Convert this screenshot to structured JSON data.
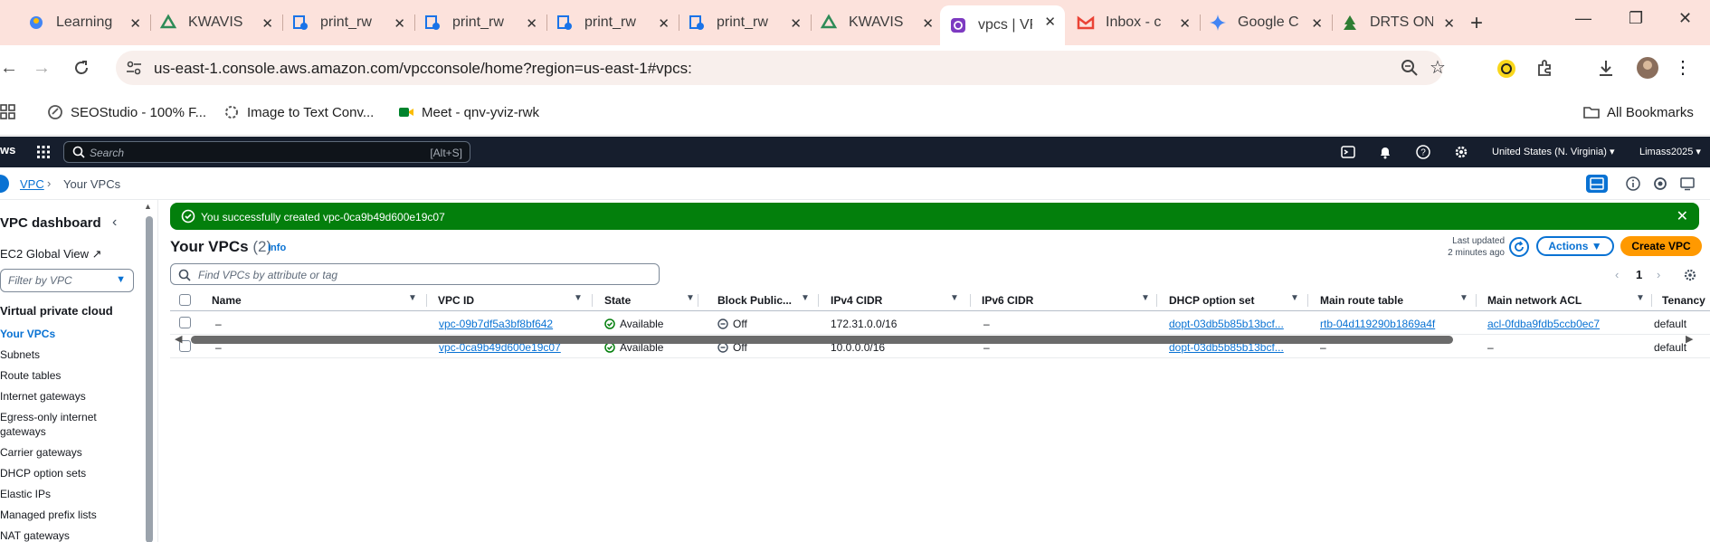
{
  "browser": {
    "tabs": [
      {
        "title": "Learning",
        "icon": "learning-icon",
        "color": "#4285f4",
        "active": false
      },
      {
        "title": "KWAVIS",
        "icon": "kwavis-icon",
        "color": "#2e8b57",
        "active": false
      },
      {
        "title": "print_rw",
        "icon": "print-icon",
        "color": "#1a73e8",
        "active": false
      },
      {
        "title": "print_rw",
        "icon": "print-icon",
        "color": "#1a73e8",
        "active": false
      },
      {
        "title": "print_rw",
        "icon": "print-icon",
        "color": "#1a73e8",
        "active": false
      },
      {
        "title": "print_rw",
        "icon": "print-icon",
        "color": "#1a73e8",
        "active": false
      },
      {
        "title": "KWAVIS",
        "icon": "kwavis-icon",
        "color": "#2e8b57",
        "active": false
      },
      {
        "title": "vpcs | VP",
        "icon": "vpc-icon",
        "color": "#7d3ac1",
        "active": true
      },
      {
        "title": "Inbox - c",
        "icon": "gmail-icon",
        "color": "#ea4335",
        "active": false
      },
      {
        "title": "Google C",
        "icon": "gemini-icon",
        "color": "#4285f4",
        "active": false
      },
      {
        "title": "DRTS ON",
        "icon": "drts-icon",
        "color": "#2e7d32",
        "active": false
      }
    ],
    "url": "us-east-1.console.aws.amazon.com/vpcconsole/home?region=us-east-1#vpcs:",
    "bookmarks": [
      {
        "label": "SEOStudio - 100% F...",
        "icon": "seostudio-icon"
      },
      {
        "label": "Image to Text Conv...",
        "icon": "image-to-text-icon"
      },
      {
        "label": "Meet - qnv-yviz-rwk",
        "icon": "meet-icon"
      }
    ],
    "all_bookmarks": "All Bookmarks"
  },
  "aws": {
    "logo": "ws",
    "search_placeholder": "Search",
    "search_shortcut": "[Alt+S]",
    "region": "United States (N. Virginia) ▾",
    "account": "Limass2025 ▾"
  },
  "breadcrumb": {
    "root": "VPC",
    "current": "Your VPCs"
  },
  "sidebar": {
    "title": "VPC dashboard",
    "global_view": "EC2 Global View",
    "filter_placeholder": "Filter by VPC",
    "section": "Virtual private cloud",
    "items": [
      {
        "label": "Your VPCs",
        "current": true
      },
      {
        "label": "Subnets"
      },
      {
        "label": "Route tables"
      },
      {
        "label": "Internet gateways"
      },
      {
        "label": "Egress-only internet gateways"
      },
      {
        "label": "Carrier gateways"
      },
      {
        "label": "DHCP option sets"
      },
      {
        "label": "Elastic IPs"
      },
      {
        "label": "Managed prefix lists"
      },
      {
        "label": "NAT gateways"
      }
    ]
  },
  "flash": {
    "message": "You successfully created vpc-0ca9b49d600e19c07",
    "color": "#037f0c"
  },
  "header": {
    "title": "Your VPCs",
    "count": "(2)",
    "info": "Info",
    "last_updated_line1": "Last updated",
    "last_updated_line2": "2 minutes ago",
    "actions": "Actions ▼",
    "create": "Create VPC"
  },
  "find_placeholder": "Find VPCs by attribute or tag",
  "pagination": {
    "page": "1"
  },
  "table": {
    "columns": [
      "Name",
      "VPC ID",
      "State",
      "Block Public...",
      "IPv4 CIDR",
      "IPv6 CIDR",
      "DHCP option set",
      "Main route table",
      "Main network ACL",
      "Tenancy"
    ],
    "rows": [
      {
        "name": "–",
        "vpc_id": "vpc-09b7df5a3bf8bf642",
        "state": "Available",
        "block": "Off",
        "ipv4": "172.31.0.0/16",
        "ipv6": "–",
        "dhcp": "dopt-03db5b85b13bcf...",
        "route": "rtb-04d119290b1869a4f",
        "acl": "acl-0fdba9fdb5ccb0ec7",
        "tenancy": "default"
      },
      {
        "name": "–",
        "vpc_id": "vpc-0ca9b49d600e19c07",
        "state": "Available",
        "block": "Off",
        "ipv4": "10.0.0.0/16",
        "ipv6": "–",
        "dhcp": "dopt-03db5b85b13bcf...",
        "route": "–",
        "acl": "–",
        "tenancy": "default"
      }
    ]
  }
}
